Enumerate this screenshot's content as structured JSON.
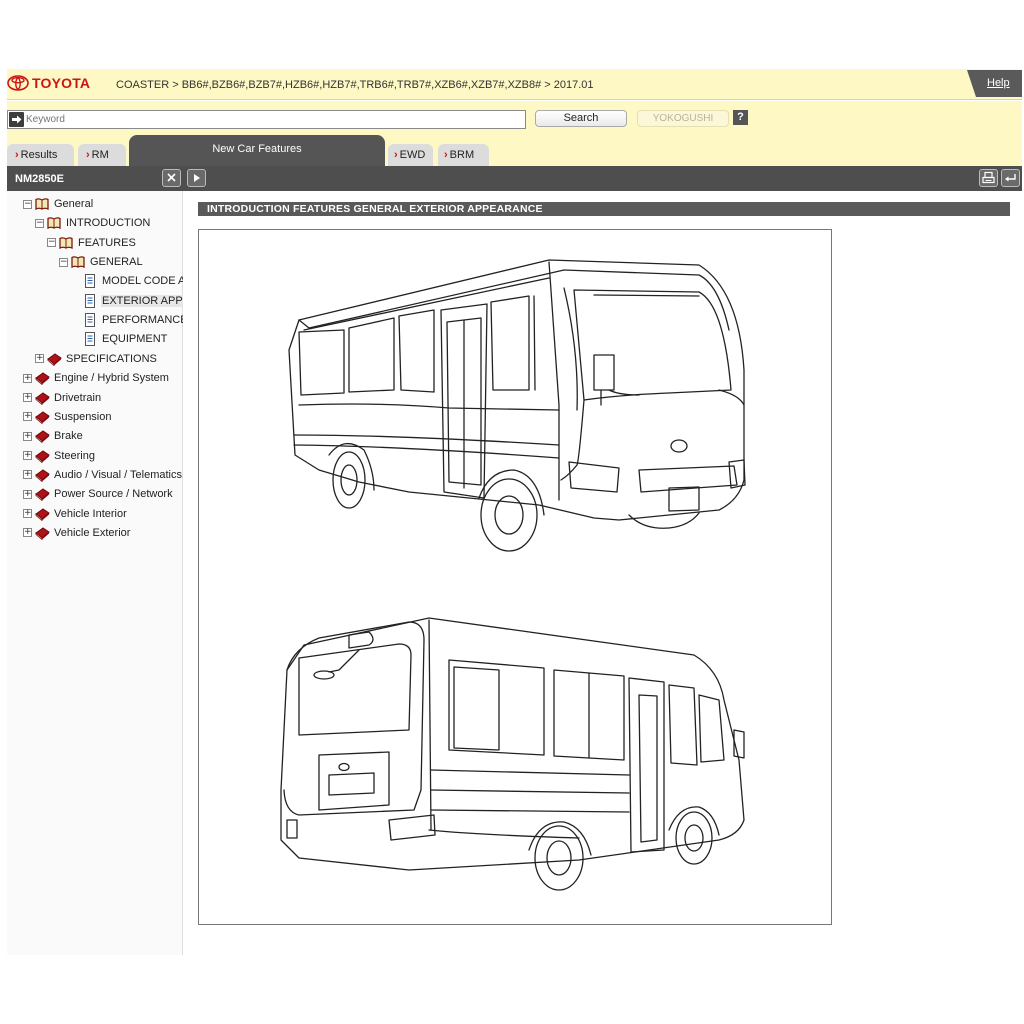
{
  "header": {
    "brand": "TOYOTA",
    "breadcrumb": "COASTER > BB6#,BZB6#,BZB7#,HZB6#,HZB7#,TRB6#,TRB7#,XZB6#,XZB7#,XZB8# > 2017.01",
    "help_label": "Help"
  },
  "search": {
    "placeholder": "Keyword",
    "value": "",
    "search_label": "Search",
    "yokogushi_label": "YOKOGUSHI",
    "help_icon_label": "?"
  },
  "tabs": [
    {
      "label": "Results"
    },
    {
      "label": "RM"
    },
    {
      "label": "New Car Features",
      "active": true
    },
    {
      "label": "EWD"
    },
    {
      "label": "BRM"
    }
  ],
  "left_panel": {
    "title": "NM2850E",
    "close_icon": "close-icon",
    "expand_icon": "play-icon"
  },
  "tree": [
    {
      "label": "General",
      "toggle": "−",
      "icon": "open-book-icon"
    },
    {
      "label": "INTRODUCTION",
      "toggle": "−",
      "icon": "open-book-icon"
    },
    {
      "label": "FEATURES",
      "toggle": "−",
      "icon": "open-book-icon"
    },
    {
      "label": "GENERAL",
      "toggle": "−",
      "icon": "open-book-icon"
    },
    {
      "label": "MODEL CODE AND",
      "icon": "document-icon"
    },
    {
      "label": "EXTERIOR APPEAR",
      "icon": "document-icon",
      "selected": true
    },
    {
      "label": "PERFORMANCE",
      "icon": "document-icon"
    },
    {
      "label": "EQUIPMENT",
      "icon": "document-icon"
    },
    {
      "label": "SPECIFICATIONS",
      "toggle": "+",
      "icon": "closed-book-icon"
    },
    {
      "label": "Engine / Hybrid System",
      "toggle": "+",
      "icon": "closed-book-icon"
    },
    {
      "label": "Drivetrain",
      "toggle": "+",
      "icon": "closed-book-icon"
    },
    {
      "label": "Suspension",
      "toggle": "+",
      "icon": "closed-book-icon"
    },
    {
      "label": "Brake",
      "toggle": "+",
      "icon": "closed-book-icon"
    },
    {
      "label": "Steering",
      "toggle": "+",
      "icon": "closed-book-icon"
    },
    {
      "label": "Audio / Visual / Telematics",
      "toggle": "+",
      "icon": "closed-book-icon"
    },
    {
      "label": "Power Source / Network",
      "toggle": "+",
      "icon": "closed-book-icon"
    },
    {
      "label": "Vehicle Interior",
      "toggle": "+",
      "icon": "closed-book-icon"
    },
    {
      "label": "Vehicle Exterior",
      "toggle": "+",
      "icon": "closed-book-icon"
    }
  ],
  "content": {
    "section_title": "INTRODUCTION  FEATURES  GENERAL  EXTERIOR APPEARANCE",
    "print_icon": "print-icon",
    "back_icon": "return-icon"
  },
  "colors": {
    "header_bg": "#fdf8c4",
    "brand_red": "#cc1417",
    "dark_bar": "#4e4e4e"
  }
}
